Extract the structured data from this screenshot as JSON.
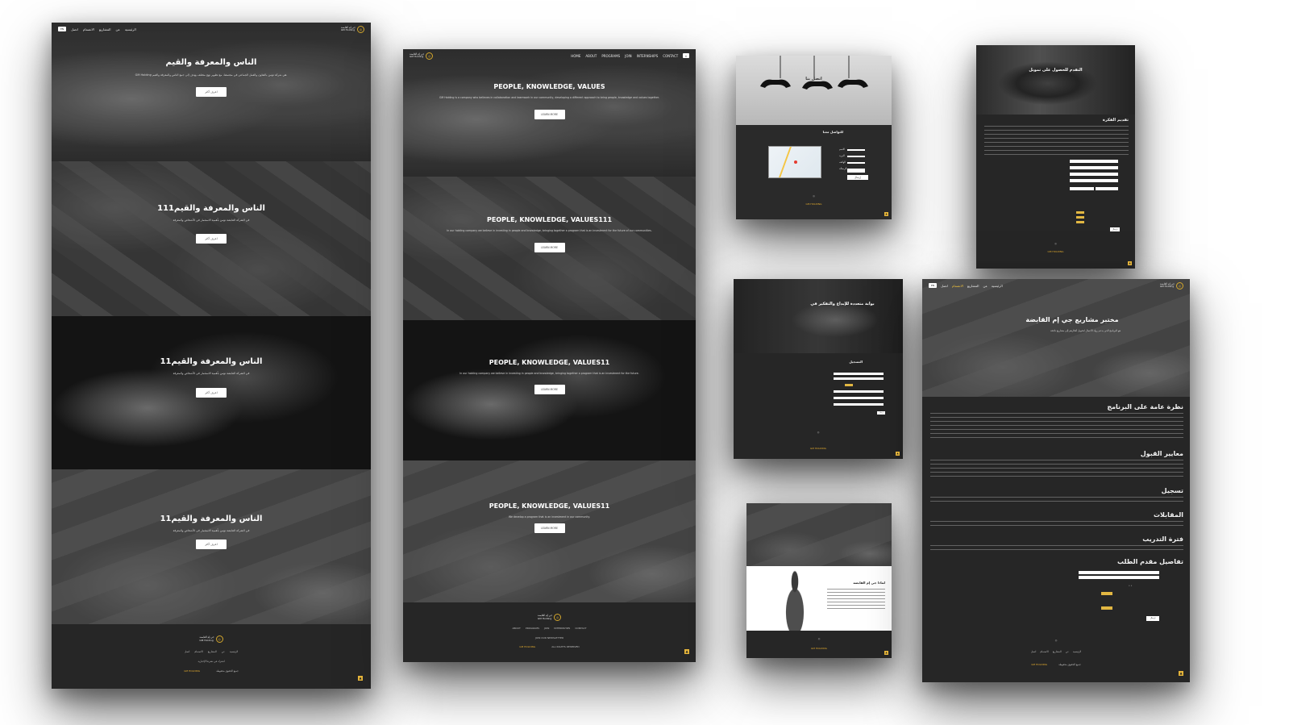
{
  "brand": {
    "name_ar": "جي إم القابضة",
    "name_en": "GM Holding",
    "lang_toggle": "EN",
    "lang_toggle_ar": "ع"
  },
  "nav_ar": [
    "الرئيسية",
    "عن",
    "المشاريع",
    "الانضمام",
    "اتصل"
  ],
  "nav_en": [
    "HOME",
    "ABOUT",
    "PROGRAMS",
    "JOIN",
    "INTERNSHIPS",
    "CONTACT"
  ],
  "shot1": {
    "sections": [
      {
        "title": "الناس والمعرفة والقيم",
        "text": "GM Holding هي شركة تؤمن بالتعاون والعمل الجماعي في مجتمعنا، مع تطوير نهج مختلف يهدف إلى جمع الناس والمعرفة والقيم.",
        "button": "اعرف أكثر"
      },
      {
        "title": "111الناس والمعرفة والقيم",
        "text": "في الشركة القابضة نؤمن بأهمية الاستثمار في الأشخاص والمعرفة",
        "button": "اعرف أكثر"
      },
      {
        "title": "11الناس والمعرفة والقيم",
        "text": "في الشركة القابضة نؤمن بأهمية الاستثمار في الأشخاص والمعرفة",
        "button": "اعرف أكثر"
      },
      {
        "title": "11الناس والمعرفة والقيم",
        "text": "في الشركة القابضة نؤمن بأهمية الاستثمار في الأشخاص والمعرفة",
        "button": "اعرف أكثر"
      }
    ],
    "footer": {
      "links": [
        "الرئيسية",
        "عن",
        "المشاريع",
        "الانضمام",
        "اتصل"
      ],
      "line1": "اشترك في نشرتنا الإخبارية",
      "copyright": "جميع الحقوق محفوظة",
      "credit": "GM HOLDING"
    }
  },
  "shot2": {
    "sections": [
      {
        "title": "PEOPLE, KNOWLEDGE, VALUES",
        "text": "GM Holding is a company who believes in collaboration and teamwork in our community, developing a different approach to bring people, knowledge and values together.",
        "button": "LEARN MORE"
      },
      {
        "title": "PEOPLE, KNOWLEDGE, VALUES111",
        "text": "In our holding company we believe in investing in people and knowledge, bringing together a program that is an investment for the future of our communities.",
        "button": "LEARN MORE"
      },
      {
        "title": "PEOPLE, KNOWLEDGE, VALUES11",
        "text": "In our holding company we believe in investing in people and knowledge, bringing together a program that is an investment for the future.",
        "button": "LEARN MORE"
      },
      {
        "title": "PEOPLE, KNOWLEDGE, VALUES11",
        "text": "We develop a program that is an investment in our community.",
        "button": "LEARN MORE"
      }
    ],
    "footer": {
      "links": [
        "ABOUT",
        "PROGRAMS",
        "JOIN",
        "INTERNSHIPS",
        "CONTACT"
      ],
      "line1": "JOIN OUR NEWSLETTER",
      "copyright": "ALL RIGHTS RESERVED",
      "credit": "GM HOLDING"
    }
  },
  "shot3": {
    "title": "اتصل بنا",
    "subtitle": "للتواصل معنا",
    "form_labels": [
      "الاسم",
      "البريد",
      "الهاتف",
      "الرسالة"
    ],
    "submit": "إرسال"
  },
  "shot4": {
    "hero": "التقدم للحصول على تمويل",
    "section": "تقديم الفكرة",
    "submit": "إرسال"
  },
  "shot5": {
    "hero": "بوابة متعددة للإبداع والتفكير في",
    "section": "التسجيل",
    "submit": "إرسال"
  },
  "shot6": {
    "hero": "",
    "section": "لماذا جي إم القابضة",
    "submit": ""
  },
  "shot7": {
    "hero": "مختبر مشاريع جي إم القابضة",
    "hero_text": "هو البرنامج الذي يدعم رواد الأعمال لتحويل أفكارهم إلى مشاريع ناجحة",
    "sections": [
      "نظرة عامة على البرنامج",
      "معايير القبول",
      "تسجيل",
      "المقابلات",
      "فترة التدريب",
      "تفاصيل مقدم الطلب"
    ],
    "submit": "إرسال"
  },
  "totop": "▲"
}
